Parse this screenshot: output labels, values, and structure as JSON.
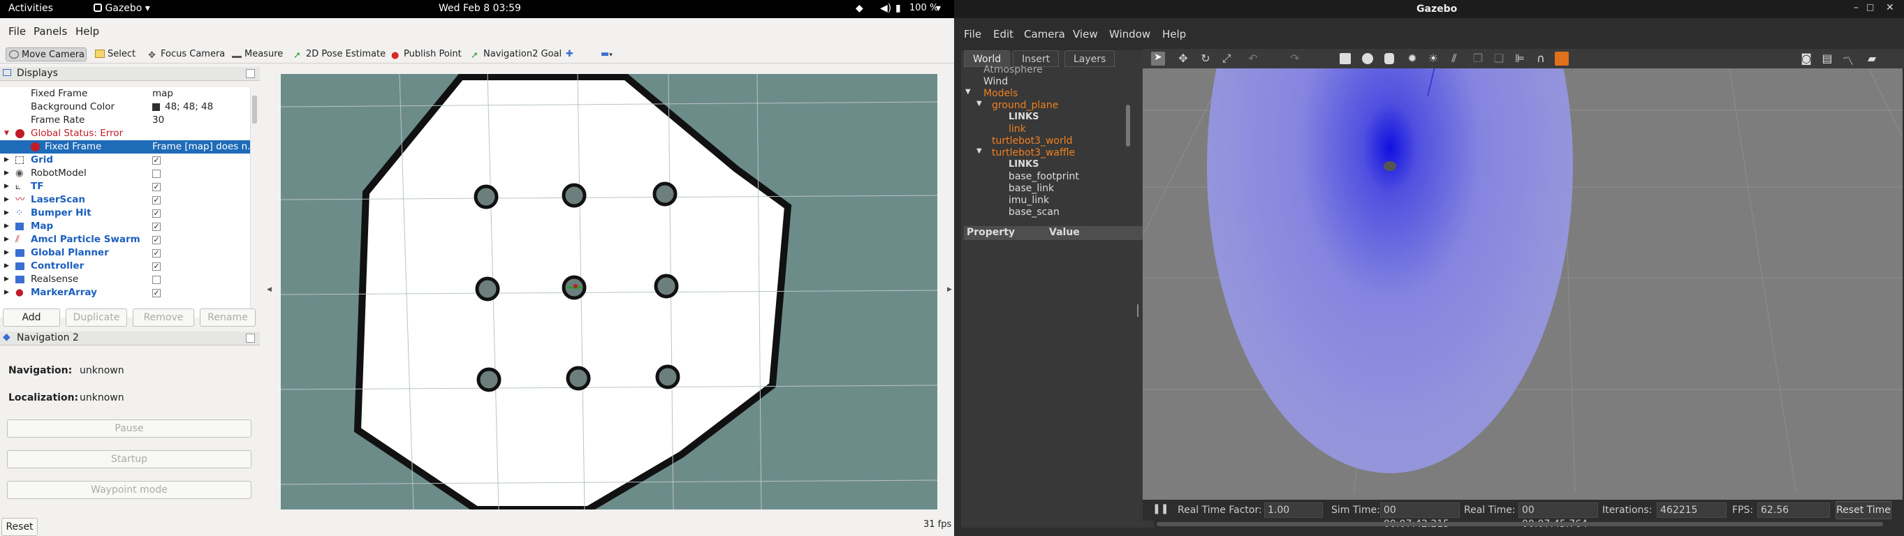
{
  "topbar": {
    "activities": "Activities",
    "app": "Gazebo",
    "clock": "Wed Feb 8  03:59",
    "battery": "100 %"
  },
  "rviz": {
    "menu": [
      "File",
      "Panels",
      "Help"
    ],
    "tools": [
      "Move Camera",
      "Select",
      "Focus Camera",
      "Measure",
      "2D Pose Estimate",
      "Publish Point",
      "Navigation2 Goal"
    ],
    "displays_title": "Displays",
    "global_options": [
      {
        "label": "Fixed Frame",
        "value": "map"
      },
      {
        "label": "Background Color",
        "value": "48; 48; 48"
      },
      {
        "label": "Frame Rate",
        "value": "30"
      }
    ],
    "global_status": "Global Status: Error",
    "fixed_frame_err": {
      "label": "Fixed Frame",
      "value": "Frame [map] does n..."
    },
    "displays": [
      {
        "name": "Grid",
        "checked": true
      },
      {
        "name": "RobotModel",
        "checked": false
      },
      {
        "name": "TF",
        "checked": true
      },
      {
        "name": "LaserScan",
        "checked": true
      },
      {
        "name": "Bumper Hit",
        "checked": true
      },
      {
        "name": "Map",
        "checked": true
      },
      {
        "name": "Amcl Particle Swarm",
        "checked": true
      },
      {
        "name": "Global Planner",
        "checked": true
      },
      {
        "name": "Controller",
        "checked": true
      },
      {
        "name": "Realsense",
        "checked": false
      },
      {
        "name": "MarkerArray",
        "checked": true
      }
    ],
    "buttons": {
      "add": "Add",
      "duplicate": "Duplicate",
      "remove": "Remove",
      "rename": "Rename"
    },
    "nav2": {
      "title": "Navigation 2",
      "navigation_label": "Navigation:",
      "navigation_value": "unknown",
      "localization_label": "Localization:",
      "localization_value": "unknown",
      "pause": "Pause",
      "startup": "Startup",
      "waypoint": "Waypoint mode"
    },
    "reset": "Reset",
    "fps": "31 fps",
    "colors": {
      "viewport_bg": "#6c8c8a",
      "selection": "#1e6bb8",
      "error": "#c01c28",
      "display_name": "#1b5fbf"
    }
  },
  "gazebo": {
    "title": "Gazebo",
    "menu": [
      "File",
      "Edit",
      "Camera",
      "View",
      "Window",
      "Help"
    ],
    "tabs": [
      "World",
      "Insert",
      "Layers"
    ],
    "tree": [
      {
        "text": "Atmosphere",
        "indent": 1,
        "orange": false
      },
      {
        "text": "Wind",
        "indent": 1,
        "orange": false
      },
      {
        "text": "Models",
        "indent": 0,
        "orange": true
      },
      {
        "text": "ground_plane",
        "indent": 1,
        "orange": true
      },
      {
        "text": "LINKS",
        "indent": 2,
        "orange": false
      },
      {
        "text": "link",
        "indent": 2,
        "orange": true
      },
      {
        "text": "turtlebot3_world",
        "indent": 1,
        "orange": true
      },
      {
        "text": "turtlebot3_waffle",
        "indent": 1,
        "orange": true
      },
      {
        "text": "LINKS",
        "indent": 2,
        "orange": false
      },
      {
        "text": "base_footprint",
        "indent": 2,
        "orange": false
      },
      {
        "text": "base_link",
        "indent": 2,
        "orange": false
      },
      {
        "text": "imu_link",
        "indent": 2,
        "orange": false
      },
      {
        "text": "base_scan",
        "indent": 2,
        "orange": false
      }
    ],
    "prop_header": {
      "property": "Property",
      "value": "Value"
    },
    "status": {
      "rtf_label": "Real Time Factor:",
      "rtf": "1.00",
      "sim_label": "Sim Time:",
      "sim": "00 00:07:42.215",
      "real_label": "Real Time:",
      "real": "00 00:07:45.764",
      "iter_label": "Iterations:",
      "iter": "462215",
      "fps_label": "FPS:",
      "fps": "62.56",
      "reset": "Reset Time"
    }
  }
}
